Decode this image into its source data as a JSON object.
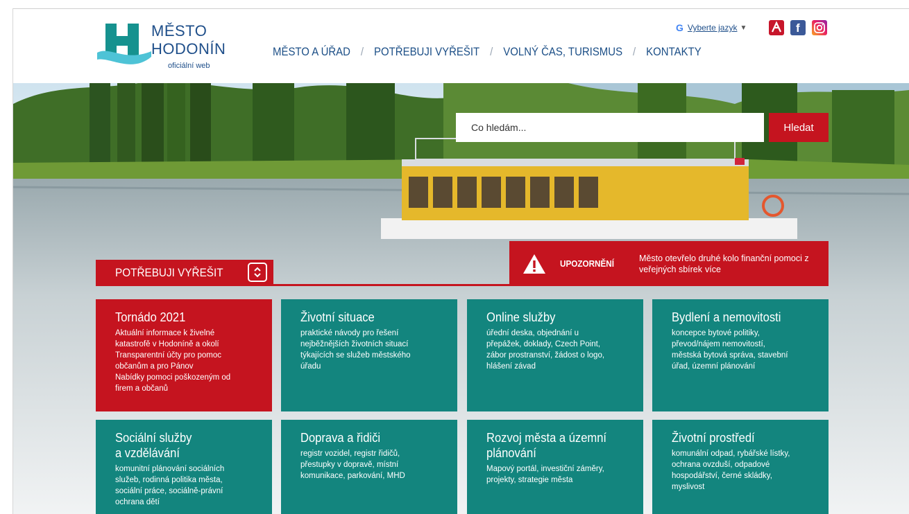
{
  "logo": {
    "line1": "MĚSTO",
    "line2": "HODONÍN",
    "subtitle": "oficiální web"
  },
  "nav": {
    "items": [
      "MĚSTO A ÚŘAD",
      "POTŘEBUJI VYŘEŠIT",
      "VOLNÝ ČAS, TURISMUS",
      "KONTAKTY"
    ],
    "separator": "/"
  },
  "language": {
    "google_letter": "G",
    "label": "Vyberte jazyk",
    "arrow": "▼"
  },
  "social": {
    "facebook_glyph": "f",
    "icons": [
      "app-icon",
      "facebook-icon",
      "instagram-icon"
    ]
  },
  "search": {
    "placeholder": "Co hledám...",
    "button": "Hledat"
  },
  "section": {
    "title": "POTŘEBUJI VYŘEŠIT"
  },
  "alert": {
    "label": "UPOZORNĚNÍ",
    "message": "Město otevřelo druhé kolo finanční pomoci z veřejných sbírek",
    "more": "více"
  },
  "tiles": [
    {
      "title": "Tornádo 2021",
      "text": "Aktuální informace k živelné\nkatastrofě v Hodoníně a okolí\nTransparentní účty pro pomoc\nobčanům a pro Pánov\nNabídky pomoci poškozeným od\nfirem a občanů"
    },
    {
      "title": "Životní situace",
      "text": "praktické návody pro řešení\nnejběžnějších životních situací\ntýkajících se služeb městského\núřadu"
    },
    {
      "title": "Online služby",
      "text": "úřední deska, objednání u\npřepážek, doklady, Czech Point,\nzábor prostranství, žádost o logo,\nhlášení závad"
    },
    {
      "title": "Bydlení a nemovitosti",
      "text": "koncepce bytové politiky,\npřevod/nájem nemovitostí,\nměstská bytová správa, stavební\núřad, územní plánování"
    },
    {
      "title": "Sociální služby\na vzdělávání",
      "text": "komunitní plánování sociálních\nslužeb, rodinná politika města,\nsociální práce, sociálně-právní\nochrana dětí"
    },
    {
      "title": "Doprava a řidiči",
      "text": "registr vozidel, registr řidičů,\npřestupky v dopravě, místní\nkomunikace, parkování, MHD"
    },
    {
      "title": "Rozvoj města a územní\nplánování",
      "text": "Mapový portál, investiční záměry,\nprojekty, strategie města"
    },
    {
      "title": "Životní prostředí",
      "text": "komunální odpad, rybářské lístky,\nochrana ovzduší, odpadové\nhospodářství, černé skládky,\nmyslivost"
    }
  ],
  "colors": {
    "brand_blue": "#1f4f8a",
    "accent_red": "#c5141f",
    "tile_teal": "#13857e",
    "logo_teal": "#16928f"
  }
}
